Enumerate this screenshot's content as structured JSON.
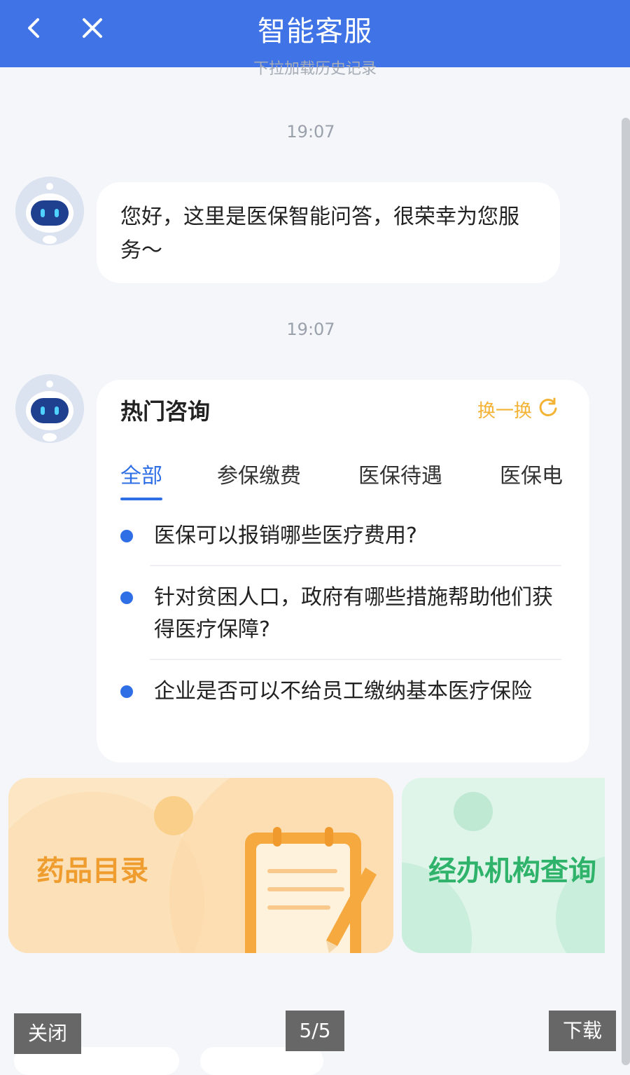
{
  "header": {
    "title": "智能客服"
  },
  "history_hint": "下拉加载历史记录",
  "messages": {
    "time1": "19:07",
    "greeting": "您好，这里是医保智能问答，很荣幸为您服务～",
    "time2": "19:07"
  },
  "hot_card": {
    "title": "热门咨询",
    "refresh_label": "换一换",
    "tabs": [
      "全部",
      "参保缴费",
      "医保待遇",
      "医保电"
    ],
    "questions": [
      "医保可以报销哪些医疗费用?",
      "针对贫困人口，政府有哪些措施帮助他们获得医疗保障?",
      "企业是否可以不给员工缴纳基本医疗保险"
    ]
  },
  "banners": {
    "drug_catalog": "药品目录",
    "agency_query": "经办机构查询"
  },
  "viewer": {
    "close_label": "关闭",
    "page_indicator": "5/5",
    "download_label": "下载"
  },
  "colors": {
    "header_bg": "#3f73e6",
    "accent_blue": "#2f6fe6",
    "refresh_yellow": "#f3b335",
    "drug_text": "#ef9d2f",
    "agency_text": "#2fb36b"
  },
  "icons": {
    "back": "chevron-left-icon",
    "close": "close-icon",
    "refresh": "refresh-icon",
    "avatar": "robot-avatar-icon"
  }
}
